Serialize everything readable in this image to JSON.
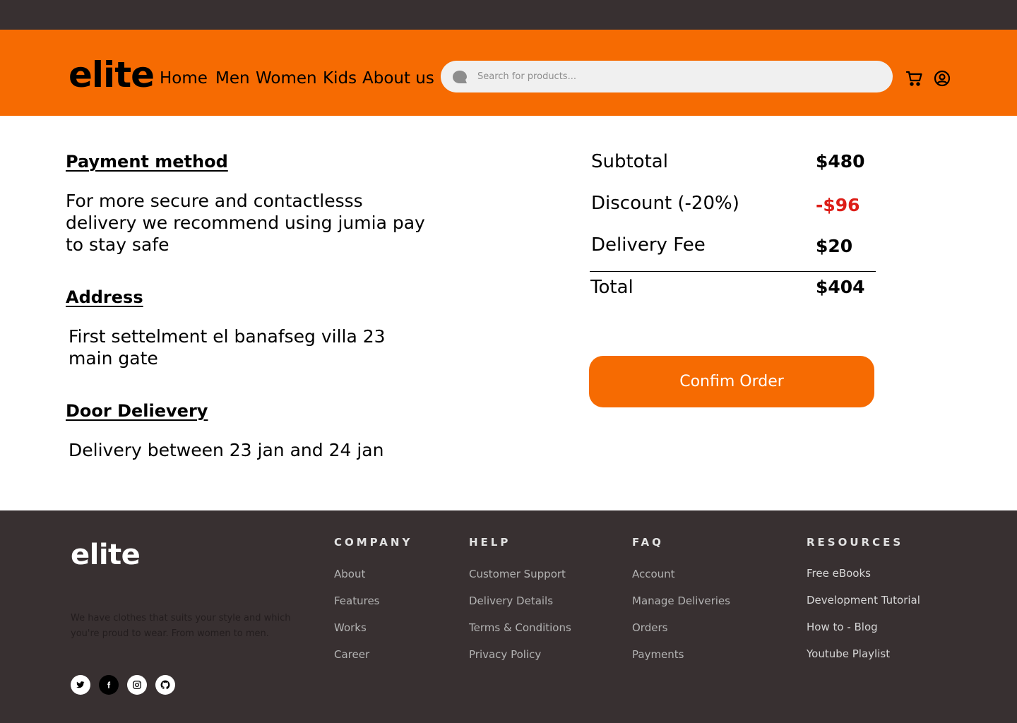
{
  "header": {
    "logo": "elite",
    "nav": [
      "Home",
      "Men",
      "Women",
      "Kids",
      "About us"
    ],
    "search_placeholder": "Search for products..."
  },
  "checkout": {
    "payment_title": "Payment method",
    "payment_text": [
      "For more secure and contactlesss",
      "delivery we recommend using jumia pay",
      "to stay safe"
    ],
    "address_title": "Address",
    "address_text": [
      "First settelment el banafseg villa 23",
      "main gate"
    ],
    "delivery_title": "Door Delievery",
    "delivery_text": "Delivery between 23 jan and 24 jan"
  },
  "summary": {
    "subtotal_label": "Subtotal",
    "subtotal_value": "$480",
    "discount_label": "Discount (-20%)",
    "discount_value": "-$96",
    "fee_label": "Delivery Fee",
    "fee_value": "$20",
    "total_label": "Total",
    "total_value": "$404",
    "confirm_label": "Confim Order"
  },
  "footer": {
    "logo": "elite",
    "tagline": "We have clothes that suits your style and which you're proud to wear. From women to men.",
    "columns": [
      {
        "heading": "COMPANY",
        "links": [
          "About",
          "Features",
          "Works",
          "Career"
        ]
      },
      {
        "heading": "HELP",
        "links": [
          "Customer Support",
          "Delivery Details",
          "Terms & Conditions",
          "Privacy Policy"
        ]
      },
      {
        "heading": "FAQ",
        "links": [
          "Account",
          "Manage Deliveries",
          "Orders",
          "Payments"
        ]
      },
      {
        "heading": "RESOURCES",
        "links": [
          "Free eBooks",
          "Development Tutorial",
          "How to - Blog",
          "Youtube Playlist"
        ]
      }
    ],
    "social": [
      "twitter-icon",
      "facebook-icon",
      "instagram-icon",
      "github-icon"
    ]
  },
  "colors": {
    "brand_orange": "#f66b02",
    "dark": "#383031",
    "discount_red": "#dd1e18"
  }
}
